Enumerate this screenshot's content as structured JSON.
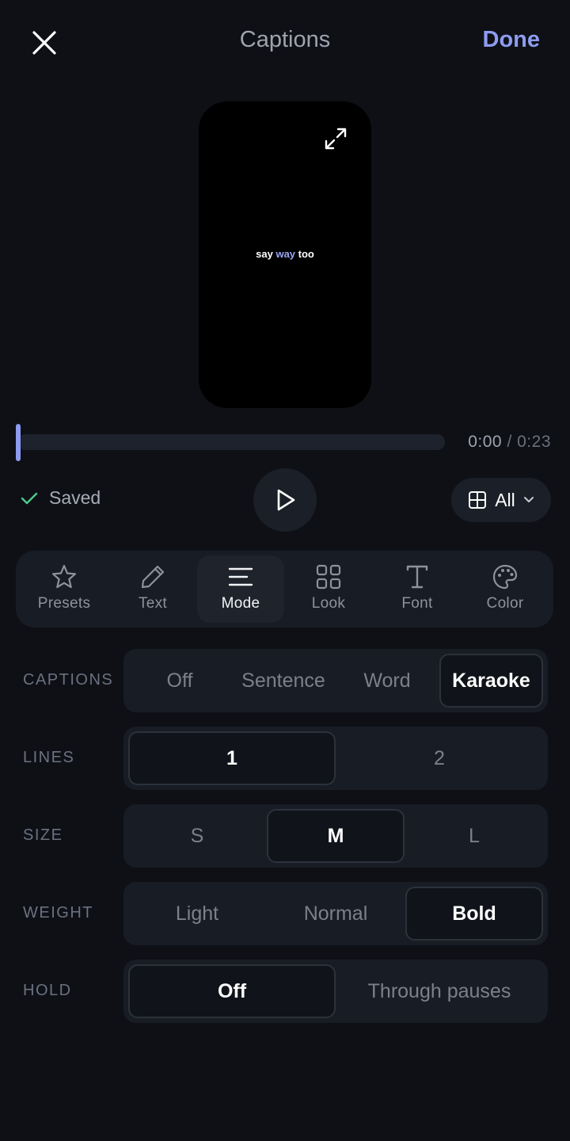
{
  "header": {
    "title": "Captions",
    "done_label": "Done"
  },
  "preview": {
    "caption_words": [
      "say",
      "way",
      "too"
    ],
    "highlight_word_index": 1,
    "highlight_color": "#9aa6f5"
  },
  "timeline": {
    "current": "0:00",
    "separator": "/",
    "duration": "0:23",
    "progress": 0.0
  },
  "controls": {
    "saved_label": "Saved",
    "scope_label": "All"
  },
  "tabs": [
    {
      "label": "Presets",
      "icon": "star-icon"
    },
    {
      "label": "Text",
      "icon": "pencil-icon"
    },
    {
      "label": "Mode",
      "icon": "align-icon",
      "active": true
    },
    {
      "label": "Look",
      "icon": "grid-icon"
    },
    {
      "label": "Font",
      "icon": "type-icon"
    },
    {
      "label": "Color",
      "icon": "palette-icon"
    }
  ],
  "settings": {
    "captions": {
      "label": "CAPTIONS",
      "options": [
        "Off",
        "Sentence",
        "Word",
        "Karaoke"
      ],
      "selected": "Karaoke"
    },
    "lines": {
      "label": "LINES",
      "options": [
        "1",
        "2"
      ],
      "selected": "1"
    },
    "size": {
      "label": "SIZE",
      "options": [
        "S",
        "M",
        "L"
      ],
      "selected": "M"
    },
    "weight": {
      "label": "WEIGHT",
      "options": [
        "Light",
        "Normal",
        "Bold"
      ],
      "selected": "Bold"
    },
    "hold": {
      "label": "HOLD",
      "options": [
        "Off",
        "Through pauses"
      ],
      "selected": "Off"
    }
  },
  "colors": {
    "accent": "#8d9cf0",
    "background": "#0e1016",
    "panel": "#181c24",
    "saved_check": "#4ecb8d"
  }
}
